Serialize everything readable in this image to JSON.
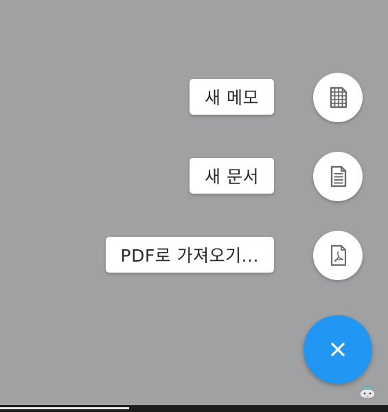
{
  "menu": {
    "items": [
      {
        "label": "새 메모",
        "icon": "grid-table-icon"
      },
      {
        "label": "새 문서",
        "icon": "document-lines-icon"
      },
      {
        "label": "PDF로 가져오기...",
        "icon": "pdf-file-icon"
      }
    ]
  },
  "fab": {
    "icon": "close-icon",
    "color": "#2196f3"
  },
  "colors": {
    "scrim": "#a0a1a3",
    "icon_stroke": "#6b6b6b"
  }
}
